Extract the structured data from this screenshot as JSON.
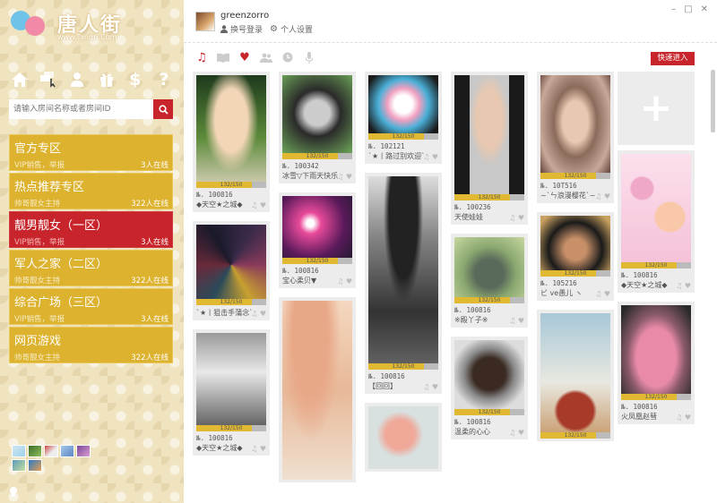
{
  "logo": {
    "brand": "唐人街",
    "sub": "www.Tangri.Com"
  },
  "nav_icons": [
    "home-icon",
    "rooms-icon",
    "user-icon",
    "gift-icon",
    "dollar-icon",
    "help-icon"
  ],
  "search": {
    "placeholder": "请输入房间名称或者房间ID"
  },
  "zones": [
    {
      "title": "官方专区",
      "sub": "VIP销售，举报",
      "count": "3人在线"
    },
    {
      "title": "热点推荐专区",
      "sub": "帅哥靓女主持",
      "count": "322人在线"
    },
    {
      "title": "靓男靓女（一区）",
      "sub": "VIP销售，举报",
      "count": "3人在线"
    },
    {
      "title": "军人之家（二区）",
      "sub": "帅哥靓女主持",
      "count": "322人在线"
    },
    {
      "title": "综合广场（三区）",
      "sub": "VIP销售，举报",
      "count": "3人在线"
    },
    {
      "title": "网页游戏",
      "sub": "帅哥靓女主持",
      "count": "322人在线"
    }
  ],
  "header": {
    "username": "greenzorro",
    "switch_label": "换号登录",
    "settings_label": "个人设置"
  },
  "filters": [
    "music-icon",
    "book-icon",
    "heart-icon",
    "group-icon",
    "clock-icon",
    "mic-icon"
  ],
  "quick_enter": "快速进入",
  "columns": [
    [
      {
        "id": "№. 100816",
        "name": "◆天空★之城◆",
        "progress": "132/150"
      },
      {
        "id": "",
        "name": "`★丨狙击手蒲念`",
        "progress": "132/150"
      },
      {
        "id": "№. 100816",
        "name": "◆天空★之城◆",
        "progress": "132/150"
      }
    ],
    [
      {
        "id": "№. 100342",
        "name": "冰雪▽下雨天快乐",
        "progress": "132/150"
      },
      {
        "id": "№. 100816",
        "name": "宝心柔贝▼",
        "progress": "132/150"
      },
      {
        "id": "",
        "name": "",
        "progress": ""
      }
    ],
    [
      {
        "id": "№. 102121",
        "name": "`★丨路过别欢迎`",
        "progress": "132/150"
      },
      {
        "id": "№. 100816",
        "name": "【回回】",
        "progress": "132/150"
      },
      {
        "id": "",
        "name": "",
        "progress": ""
      }
    ],
    [
      {
        "id": "№. 100236",
        "name": "天使娃娃",
        "progress": "132/150"
      },
      {
        "id": "№. 100816",
        "name": "※殿丫子※",
        "progress": "132/150"
      },
      {
        "id": "№. 100816",
        "name": "温柔的心心",
        "progress": "132/150"
      }
    ],
    [
      {
        "id": "№. 10T516",
        "name": "~`ㄣ浪漫樱花`~",
        "progress": "132/150"
      },
      {
        "id": "№. 105216",
        "name": "ビ ve愚儿 ヽ",
        "progress": "132/150"
      },
      {
        "id": "",
        "name": "",
        "progress": "132/150"
      }
    ],
    [
      {
        "id": "№. 100816",
        "name": "◆天空★之城◆",
        "progress": "132/150"
      },
      {
        "id": "№. 100816",
        "name": "火凤凰赵彗",
        "progress": "132/150"
      }
    ]
  ],
  "colors": {
    "accent": "#c8242b",
    "gold": "#dcb22e",
    "panel": "#efe3c0"
  }
}
